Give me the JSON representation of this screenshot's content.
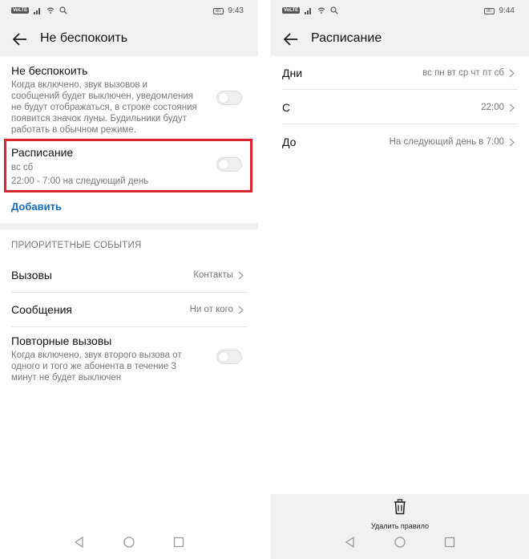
{
  "left_screen": {
    "status_bar": {
      "carrier_badge": "VoLTE",
      "battery": "80",
      "time": "9:43"
    },
    "header": {
      "title": "Не беспокоить"
    },
    "dnd": {
      "title": "Не беспокоить",
      "description_lines": [
        "Когда включено, звук вызовов и",
        "сообщений будет выключен, уведомления",
        "не будут отображаться, в строке состояния",
        "появится значок луны. Будильники будут",
        "работать в обычном режиме."
      ],
      "enabled": false
    },
    "schedule": {
      "title": "Расписание",
      "days": "вс сб",
      "time_range": "22:00 - 7:00 на следующий день",
      "enabled": false
    },
    "add_link": "Добавить",
    "priority_section": {
      "header": "ПРИОРИТЕТНЫЕ СОБЫТИЯ",
      "calls": {
        "label": "Вызовы",
        "value": "Контакты"
      },
      "messages": {
        "label": "Сообщения",
        "value": "Ни от кого"
      },
      "repeat_calls": {
        "label": "Повторные вызовы",
        "description_lines": [
          "Когда включено, звук второго вызова от",
          "одного и того же абонента в течение 3",
          "минут не будет выключен"
        ],
        "enabled": false
      }
    }
  },
  "right_screen": {
    "status_bar": {
      "carrier_badge": "VoLTE",
      "battery": "80",
      "time": "9:44"
    },
    "header": {
      "title": "Расписание"
    },
    "rows": {
      "days": {
        "label": "Дни",
        "value": "вс пн вт ср чт пт сб"
      },
      "from": {
        "label": "С",
        "value": "22:00"
      },
      "to": {
        "label": "До",
        "value": "На следующий день в 7:00"
      }
    },
    "delete_rule": {
      "label": "Удалить правило",
      "icon": "trash-icon"
    }
  },
  "colors": {
    "accent_link": "#1a6bb8",
    "highlight_border": "#d9232e",
    "header_bg": "#f1f1f1"
  }
}
